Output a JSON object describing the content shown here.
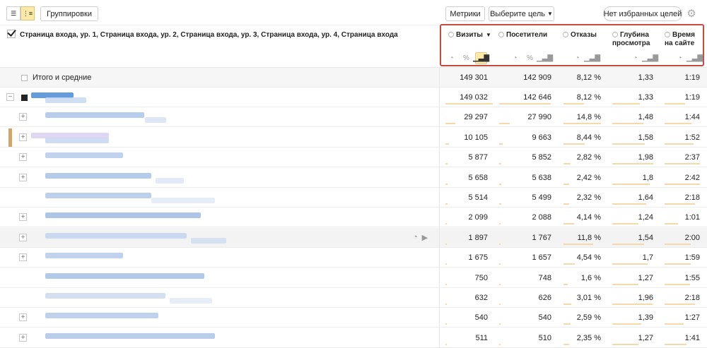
{
  "toolbar": {
    "groupings_label": "Группировки",
    "metrics_label": "Метрики",
    "goal_label": "Выберите цель",
    "favorites_label": "Нет избранных целей"
  },
  "header": {
    "grouping_text": "Страница входа, ур. 1, Страница входа, ур. 2, Страница входа, ур. 3, Страница входа, ур. 4, Страница входа",
    "columns": [
      {
        "label": "Визиты",
        "sorted": true
      },
      {
        "label": "Посетители",
        "sorted": false
      },
      {
        "label": "Отказы",
        "sorted": false
      },
      {
        "label": "Глубина просмотра",
        "sorted": false
      },
      {
        "label": "Время на сайте",
        "sorted": false
      }
    ],
    "col_visits_line1": "Визиты",
    "col_visitors_line1": "Посетители",
    "col_bounce_line1": "Отказы",
    "col_depth_line1": "Глубина",
    "col_depth_line2": "просмотра",
    "col_time_line1": "Время",
    "col_time_line2": "на сайте"
  },
  "totals": {
    "label": "Итого и средние",
    "visits": "149 301",
    "visitors": "142 909",
    "bounce": "8,12 %",
    "depth": "1,33",
    "time": "1:19"
  },
  "rows": [
    {
      "visits": "149 032",
      "visitors": "142 646",
      "bounce": "8,12 %",
      "depth": "1,33",
      "time": "1:19",
      "fv": 0.99,
      "fu": 0.99,
      "fb": 0.55,
      "fd": 0.67,
      "ft": 0.58
    },
    {
      "visits": "29 297",
      "visitors": "27 990",
      "bounce": "14,8 %",
      "depth": "1,48",
      "time": "1:44",
      "fv": 0.2,
      "fu": 0.2,
      "fb": 1.0,
      "fd": 0.75,
      "ft": 0.76
    },
    {
      "visits": "10 105",
      "visitors": "9 663",
      "bounce": "8,44 %",
      "depth": "1,58",
      "time": "1:52",
      "fv": 0.07,
      "fu": 0.07,
      "fb": 0.57,
      "fd": 0.8,
      "ft": 0.82
    },
    {
      "visits": "5 877",
      "visitors": "5 852",
      "bounce": "2,82 %",
      "depth": "1,98",
      "time": "2:37",
      "fv": 0.04,
      "fu": 0.04,
      "fb": 0.19,
      "fd": 1.0,
      "ft": 1.0
    },
    {
      "visits": "5 658",
      "visitors": "5 638",
      "bounce": "2,42 %",
      "depth": "1,8",
      "time": "2:42",
      "fv": 0.04,
      "fu": 0.04,
      "fb": 0.16,
      "fd": 0.91,
      "ft": 1.0
    },
    {
      "visits": "5 514",
      "visitors": "5 499",
      "bounce": "2,32 %",
      "depth": "1,64",
      "time": "2:18",
      "fv": 0.04,
      "fu": 0.04,
      "fb": 0.16,
      "fd": 0.83,
      "ft": 0.85
    },
    {
      "visits": "2 099",
      "visitors": "2 088",
      "bounce": "4,14 %",
      "depth": "1,24",
      "time": "1:01",
      "fv": 0.02,
      "fu": 0.02,
      "fb": 0.28,
      "fd": 0.63,
      "ft": 0.38
    },
    {
      "visits": "1 897",
      "visitors": "1 767",
      "bounce": "11,8 %",
      "depth": "1,54",
      "time": "2:00",
      "fv": 0.02,
      "fu": 0.02,
      "fb": 0.8,
      "fd": 0.78,
      "ft": 0.74
    },
    {
      "visits": "1 675",
      "visitors": "1 657",
      "bounce": "4,54 %",
      "depth": "1,7",
      "time": "1:59",
      "fv": 0.02,
      "fu": 0.02,
      "fb": 0.31,
      "fd": 0.86,
      "ft": 0.73
    },
    {
      "visits": "750",
      "visitors": "748",
      "bounce": "1,6 %",
      "depth": "1,27",
      "time": "1:55",
      "fv": 0.01,
      "fu": 0.01,
      "fb": 0.11,
      "fd": 0.64,
      "ft": 0.71
    },
    {
      "visits": "632",
      "visitors": "626",
      "bounce": "3,01 %",
      "depth": "1,96",
      "time": "2:18",
      "fv": 0.01,
      "fu": 0.01,
      "fb": 0.2,
      "fd": 0.99,
      "ft": 0.85
    },
    {
      "visits": "540",
      "visitors": "540",
      "bounce": "2,59 %",
      "depth": "1,39",
      "time": "1:27",
      "fv": 0.01,
      "fu": 0.01,
      "fb": 0.18,
      "fd": 0.7,
      "ft": 0.54
    },
    {
      "visits": "511",
      "visitors": "510",
      "bounce": "2,35 %",
      "depth": "1,27",
      "time": "1:41",
      "fv": 0.01,
      "fu": 0.01,
      "fb": 0.16,
      "fd": 0.64,
      "ft": 0.62
    }
  ],
  "colors": {
    "highlight_border": "#c84a3d",
    "active_toggle": "#ffe9a8",
    "bar": "#f5d9a8",
    "drag_handle": "#d2a56a",
    "pixel_blue": "#3f86d4"
  },
  "icons": {
    "list_view": "list-icon",
    "tree_view": "tree-icon",
    "settings": "gear-icon",
    "pie": "pie-chart-icon",
    "percent": "percent-icon",
    "bars": "bar-chart-icon",
    "play": "play-icon"
  }
}
